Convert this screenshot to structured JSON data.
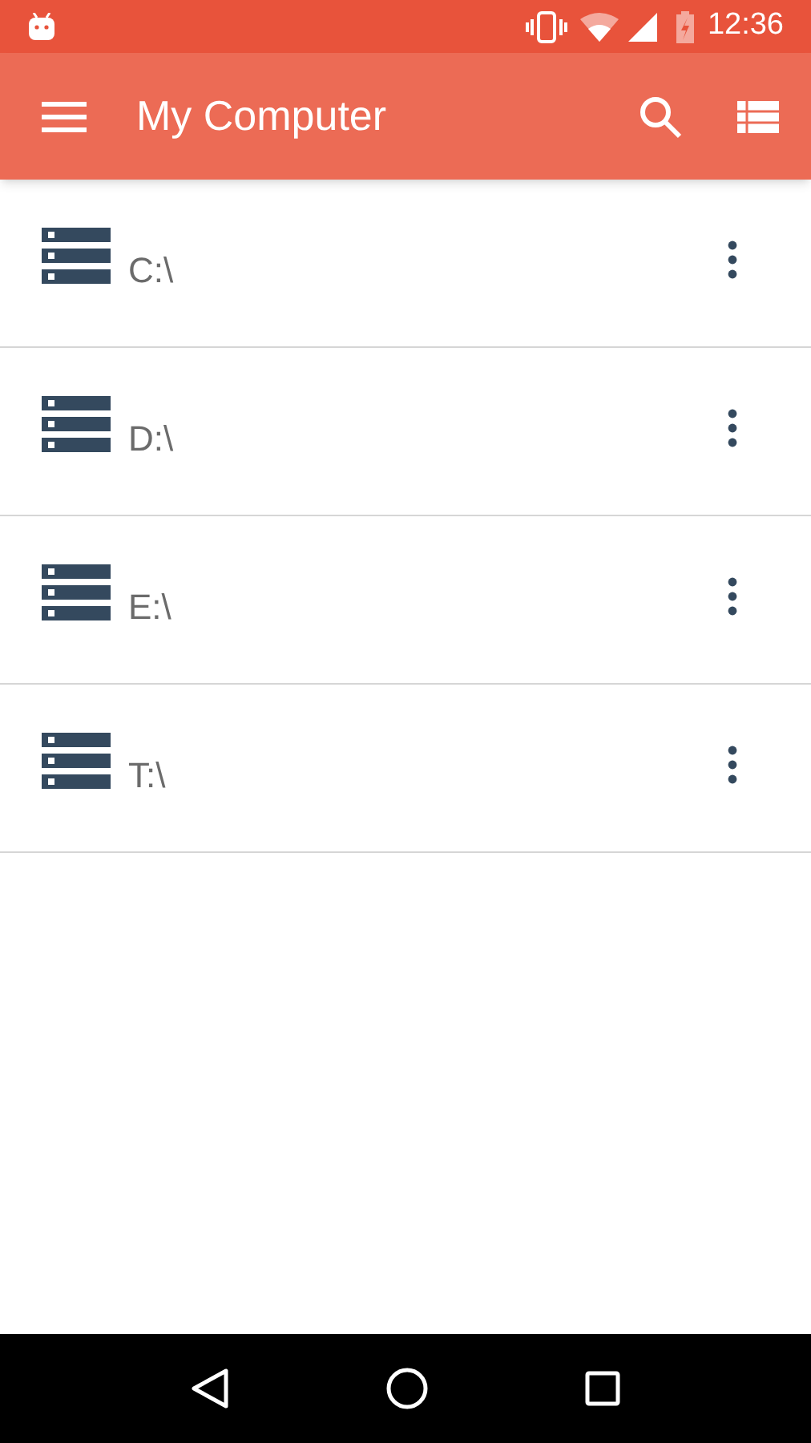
{
  "status_bar": {
    "time": "12:36"
  },
  "app_bar": {
    "title": "My Computer"
  },
  "drives": [
    {
      "label": "C:\\"
    },
    {
      "label": "D:\\"
    },
    {
      "label": "E:\\"
    },
    {
      "label": "T:\\"
    }
  ]
}
